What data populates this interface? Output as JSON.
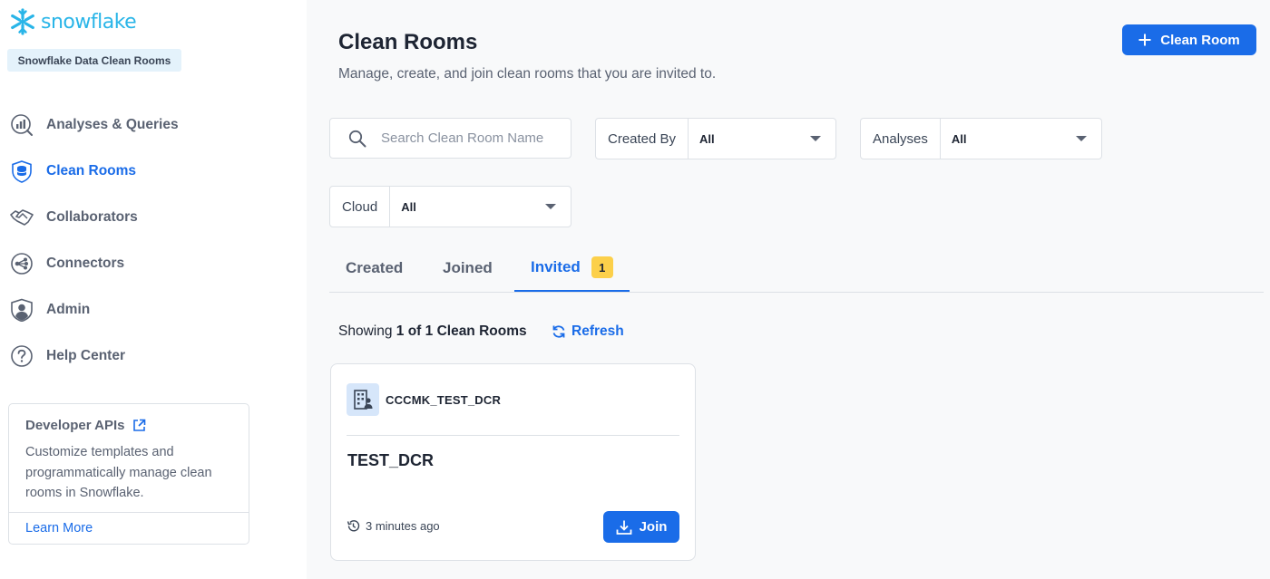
{
  "brand": {
    "logo_text": "snowflake",
    "product_name": "Snowflake Data Clean Rooms",
    "accent_color": "#29b5e8",
    "primary_color": "#1a6ce8"
  },
  "sidebar": {
    "items": [
      {
        "label": "Analyses & Queries",
        "icon": "analytics-icon",
        "active": false
      },
      {
        "label": "Clean Rooms",
        "icon": "database-shield-icon",
        "active": true
      },
      {
        "label": "Collaborators",
        "icon": "handshake-icon",
        "active": false
      },
      {
        "label": "Connectors",
        "icon": "connectors-icon",
        "active": false
      },
      {
        "label": "Admin",
        "icon": "admin-shield-icon",
        "active": false
      },
      {
        "label": "Help Center",
        "icon": "help-icon",
        "active": false
      }
    ],
    "developer_card": {
      "title": "Developer APIs",
      "description": "Customize templates and programmatically manage clean rooms in Snowflake.",
      "link": "Learn More"
    }
  },
  "header": {
    "title": "Clean Rooms",
    "subtitle": "Manage, create, and join clean rooms that you are invited to.",
    "create_button": "Clean Room"
  },
  "filters": {
    "search_placeholder": "Search Clean Room Name",
    "created_by": {
      "label": "Created By",
      "value": "All"
    },
    "analyses": {
      "label": "Analyses",
      "value": "All"
    },
    "cloud": {
      "label": "Cloud",
      "value": "All"
    }
  },
  "tabs": [
    {
      "label": "Created",
      "active": false
    },
    {
      "label": "Joined",
      "active": false
    },
    {
      "label": "Invited",
      "active": true,
      "badge": "1"
    }
  ],
  "results": {
    "prefix": "Showing",
    "count": "1 of 1 Clean Rooms",
    "refresh": "Refresh"
  },
  "rooms": [
    {
      "owner": "CCCMK_TEST_DCR",
      "name": "TEST_DCR",
      "updated": "3 minutes ago",
      "action": "Join"
    }
  ]
}
